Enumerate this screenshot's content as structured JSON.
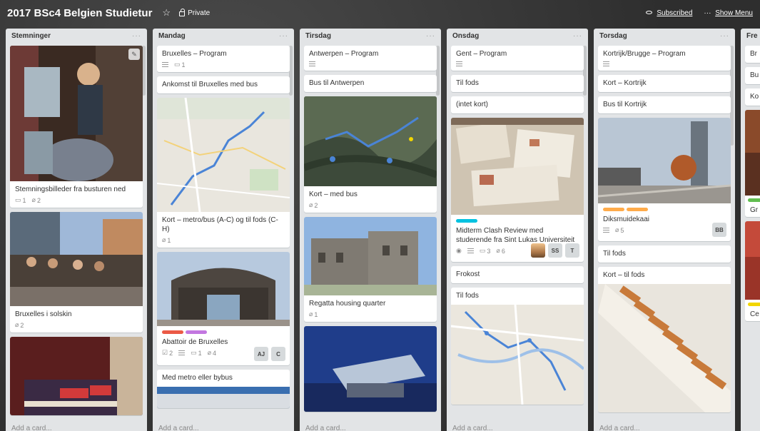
{
  "board": {
    "title": "2017 BSc4 Belgien Studietur",
    "visibility": "Private",
    "subscribed": "Subscribed",
    "show_menu": "Show Menu"
  },
  "icons": {
    "star": "star-icon",
    "lock": "lock-icon",
    "eye": "eye-icon",
    "description": "description-icon",
    "comment": "comment-icon",
    "attachment": "attachment-icon",
    "checklist": "checklist-icon"
  },
  "add_card_label": "Add a card...",
  "lists": [
    {
      "name": "Stemninger",
      "cards": [
        {
          "title": "Stemningsbilleder fra busturen ned",
          "comments": "1",
          "attachments": "2"
        },
        {
          "title": "Bruxelles i solskin",
          "attachments": "2"
        },
        {
          "title": ""
        }
      ]
    },
    {
      "name": "Mandag",
      "cards": [
        {
          "title": "Bruxelles – Program",
          "comments": "1"
        },
        {
          "title": "Ankomst til Bruxelles med bus"
        },
        {
          "title": "Kort – metro/bus (A-C) og til fods (C-H)",
          "attachments": "1"
        },
        {
          "title": "Abattoir de Bruxelles",
          "checklist": "2",
          "comments": "1",
          "attachments": "4",
          "members": [
            "AJ",
            "C"
          ]
        },
        {
          "title": "Med metro eller bybus"
        }
      ]
    },
    {
      "name": "Tirsdag",
      "cards": [
        {
          "title": "Antwerpen – Program"
        },
        {
          "title": "Bus til Antwerpen"
        },
        {
          "title": "Kort – med bus",
          "attachments": "2"
        },
        {
          "title": "Regatta housing quarter",
          "attachments": "1"
        },
        {
          "title": ""
        }
      ]
    },
    {
      "name": "Onsdag",
      "cards": [
        {
          "title": "Gent – Program"
        },
        {
          "title": "Til fods"
        },
        {
          "title": "(intet kort)"
        },
        {
          "title": "Midterm Clash Review med studerende fra Sint Lukas Universiteit",
          "comments": "3",
          "attachments": "6",
          "members": [
            "SS",
            "T"
          ]
        },
        {
          "title": "Frokost"
        },
        {
          "title": "Til fods"
        }
      ]
    },
    {
      "name": "Torsdag",
      "cards": [
        {
          "title": "Kortrijk/Brugge – Program"
        },
        {
          "title": "Kort – Kortrijk"
        },
        {
          "title": "Bus til Kortrijk"
        },
        {
          "title": "Diksmuidekaai",
          "attachments": "5",
          "members": [
            "BB"
          ]
        },
        {
          "title": "Til fods"
        },
        {
          "title": "Kort – til fods"
        }
      ]
    },
    {
      "name": "Fre",
      "cards": [
        {
          "title": "Br"
        },
        {
          "title": "Bu"
        },
        {
          "title": "Ko"
        },
        {
          "title": "Gr"
        },
        {
          "title": "Ce"
        }
      ]
    }
  ],
  "label_colors": {
    "red": "#eb5a46",
    "purple": "#c377e0",
    "orange": "#ffab4a",
    "sky": "#00c2e0",
    "green": "#61bd4f",
    "yellow": "#f2d600"
  }
}
